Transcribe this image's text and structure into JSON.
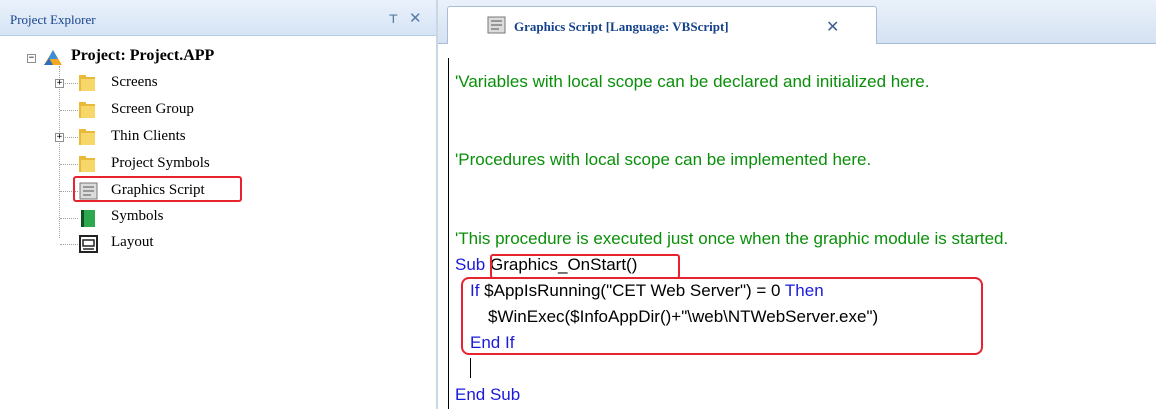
{
  "explorer": {
    "title": "Project Explorer",
    "pin_glyph": "т",
    "close_glyph": "✕",
    "root_label": "Project: Project.APP",
    "items": [
      {
        "label": "Screens",
        "icon": "folder-icon",
        "expandable": true
      },
      {
        "label": "Screen Group",
        "icon": "folder-icon",
        "expandable": false
      },
      {
        "label": "Thin Clients",
        "icon": "folder-icon",
        "expandable": true
      },
      {
        "label": "Project Symbols",
        "icon": "folder-icon",
        "expandable": false
      },
      {
        "label": "Graphics Script",
        "icon": "script-icon",
        "expandable": false,
        "highlighted": true
      },
      {
        "label": "Symbols",
        "icon": "symbols-book-icon",
        "expandable": false
      },
      {
        "label": "Layout",
        "icon": "layout-icon",
        "expandable": false
      }
    ],
    "expand_glyph": "+",
    "collapse_glyph": "−"
  },
  "editor": {
    "tab_label": "Graphics Script [Language: VBScript]",
    "tab_close_glyph": "✕",
    "code": {
      "line1": "'Variables with local scope can be declared and initialized here.",
      "line2": "'Procedures with local scope can be implemented here.",
      "line3": "'This procedure is executed just once when the graphic module is started.",
      "sub_kw": "Sub",
      "sub_name": "Graphics_OnStart()",
      "if_kw": "If",
      "if_cond": " $AppIsRunning(\"CET Web Server\") = 0 ",
      "then_kw": "Then",
      "exec_line": "$WinExec($InfoAppDir()+\"\\web\\NTWebServer.exe\")",
      "endif": "End If",
      "endsub": "End Sub"
    }
  },
  "colors": {
    "comment": "#0a8f0a",
    "keyword": "#1a1adb",
    "highlight": "#e8222e",
    "header_text": "#15428b"
  }
}
